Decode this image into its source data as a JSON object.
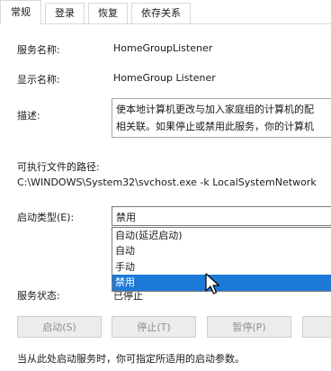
{
  "tabs": [
    "常规",
    "登录",
    "恢复",
    "依存关系"
  ],
  "service_name": {
    "label": "服务名称:",
    "value": "HomeGroupListener"
  },
  "display_name": {
    "label": "显示名称:",
    "value": "HomeGroup Listener"
  },
  "description": {
    "label": "描述:",
    "lines": [
      "使本地计算机更改与加入家庭组的计算机的配",
      "相关联。如果停止或禁用此服务，你的计算机"
    ]
  },
  "executable_path": {
    "label": "可执行文件的路径:",
    "value": "C:\\WINDOWS\\System32\\svchost.exe -k LocalSystemNetwork"
  },
  "startup_type": {
    "label": "启动类型(E):",
    "selected": "禁用",
    "options": [
      "自动(延迟启动)",
      "自动",
      "手动",
      "禁用"
    ],
    "highlighted_index": 3
  },
  "service_status": {
    "label": "服务状态:",
    "value": "已停止"
  },
  "buttons": [
    "启动(S)",
    "停止(T)",
    "暂停(P)"
  ],
  "footer_text": "当从此处启动服务时，你可指定所适用的启动参数。",
  "colors": {
    "selection": "#1e7ad8",
    "disabled_text": "#8f8f8f"
  }
}
